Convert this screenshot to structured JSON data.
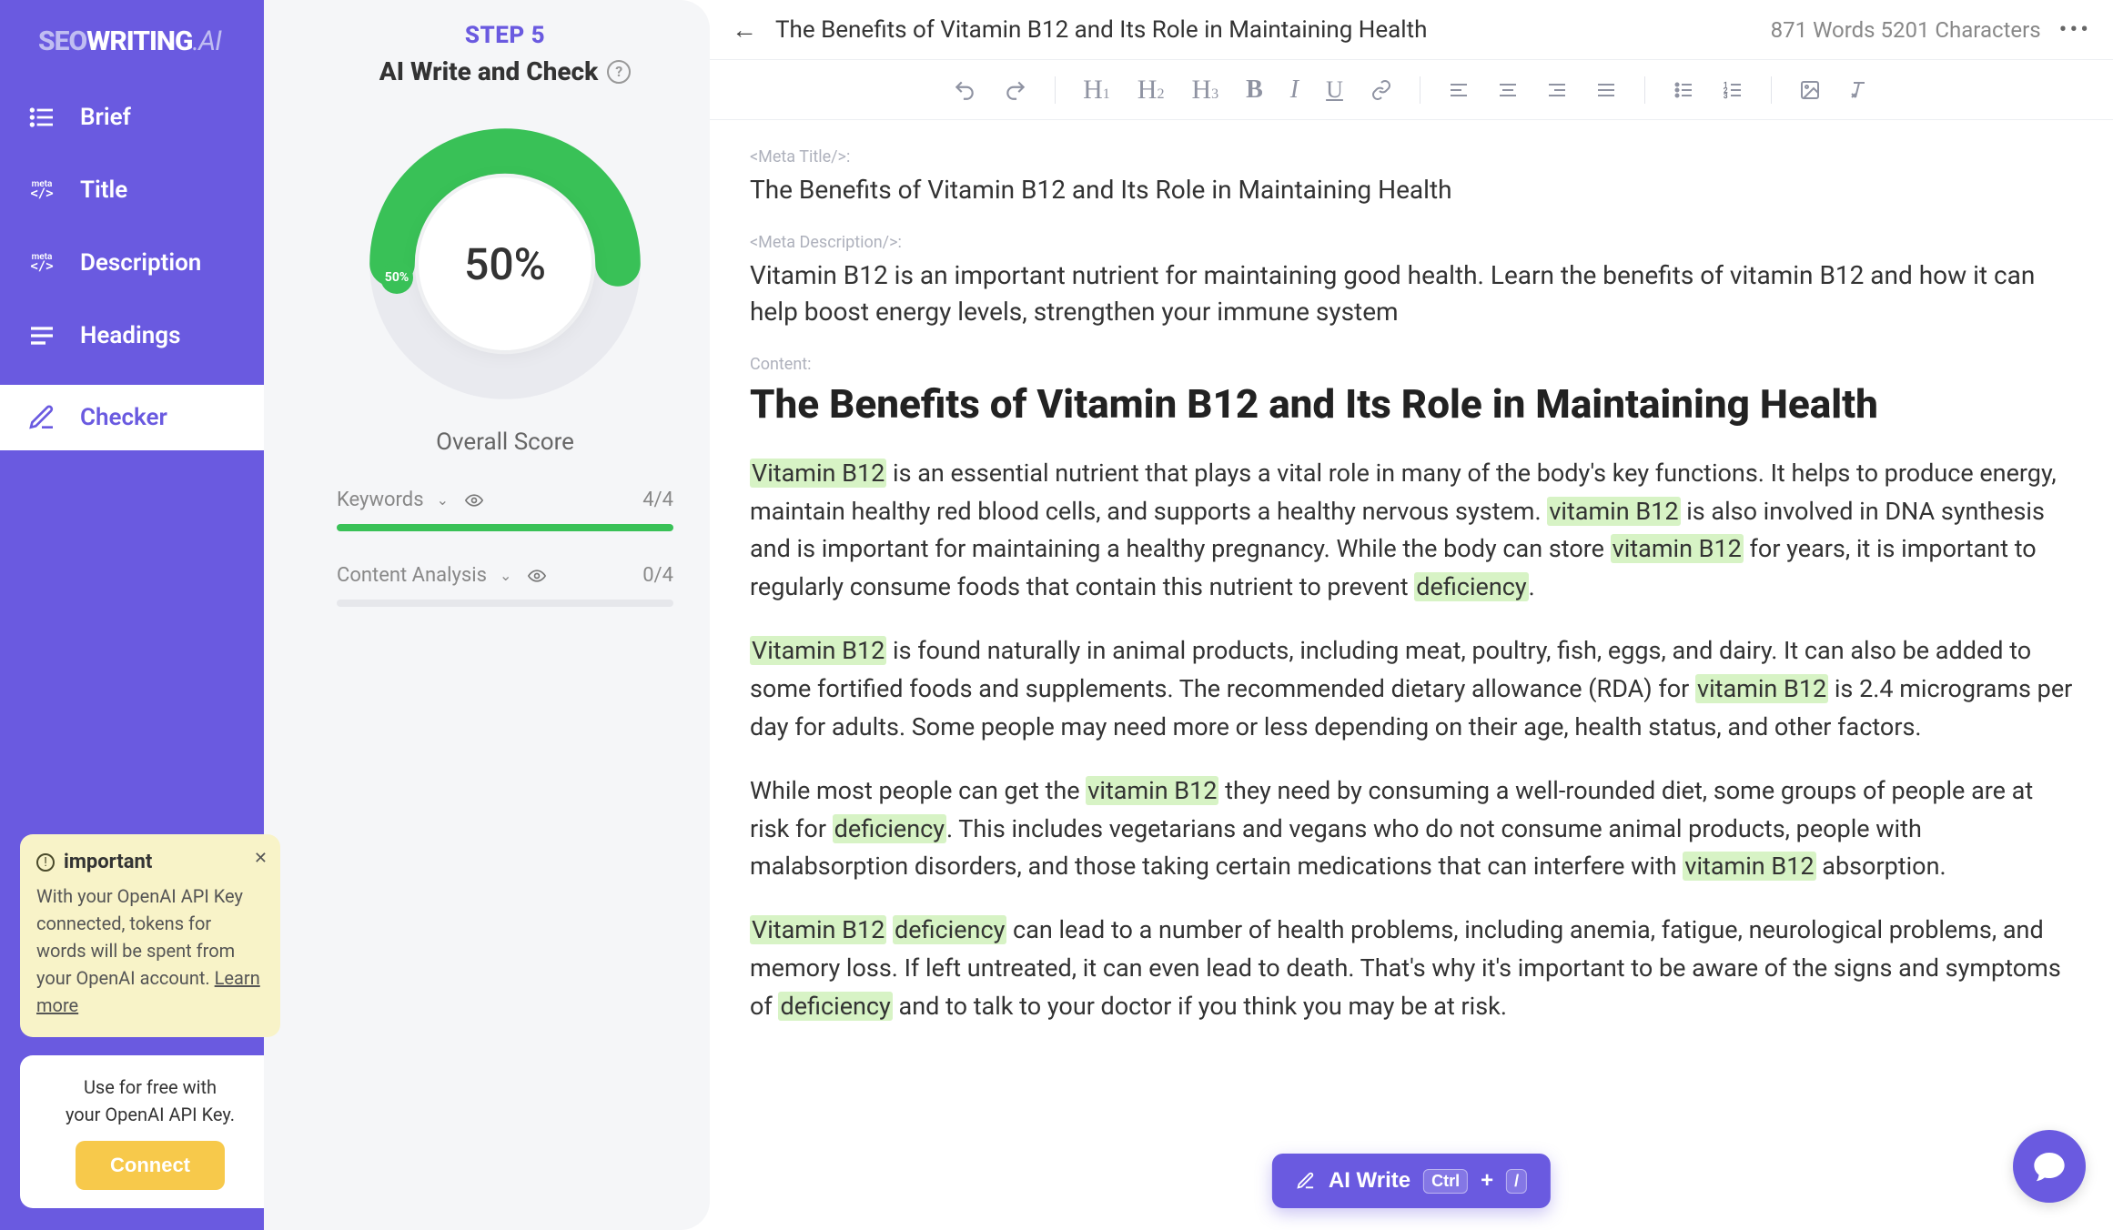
{
  "brand": {
    "part1": "SEO",
    "part2": "WRITING",
    "part3": ".AI"
  },
  "sidebar": {
    "items": [
      {
        "label": "Brief"
      },
      {
        "label": "Title"
      },
      {
        "label": "Description"
      },
      {
        "label": "Headings"
      },
      {
        "label": "Checker"
      }
    ],
    "note": {
      "title": "important",
      "body_prefix": "With your OpenAI API Key connected, tokens for words will be spent from your OpenAI account. ",
      "learn_more": "Learn more"
    },
    "connect": {
      "line1": "Use for free with",
      "line2": "your OpenAI API Key.",
      "button": "Connect"
    }
  },
  "score": {
    "step": "STEP 5",
    "title": "AI Write and Check",
    "percent": "50%",
    "badge": "50%",
    "overall": "Overall Score",
    "metrics": [
      {
        "label": "Keywords",
        "value": "4/4",
        "fill": 100,
        "color": "#39c157"
      },
      {
        "label": "Content Analysis",
        "value": "0/4",
        "fill": 0,
        "color": "#d8dae0"
      }
    ]
  },
  "editor": {
    "title": "The Benefits of Vitamin B12 and Its Role in Maintaining Health",
    "stats": "871 Words 5201 Characters",
    "meta_title_label": "<Meta Title/>:",
    "meta_title": "The Benefits of Vitamin B12 and Its Role in Maintaining Health",
    "meta_desc_label": "<Meta Description/>:",
    "meta_desc": "Vitamin B12 is an important nutrient for maintaining good health. Learn the benefits of vitamin B12 and how it can help boost energy levels, strengthen your immune system",
    "content_label": "Content:",
    "h1": "The Benefits of Vitamin B12 and Its Role in Maintaining Health",
    "p1_a": "Vitamin B12",
    "p1_b": " is an essential nutrient that plays a vital role in many of the body's key functions. It helps to produce energy, maintain healthy red blood cells, and supports a healthy nervous system. ",
    "p1_c": "vitamin B12",
    "p1_d": " is also involved in DNA synthesis and is important for maintaining a healthy pregnancy. While the body can store ",
    "p1_e": "vitamin B12",
    "p1_f": " for years, it is important to regularly consume foods that contain this nutrient to prevent ",
    "p1_g": "deficiency",
    "p1_h": ".",
    "p2_a": "Vitamin B12",
    "p2_b": " is found naturally in animal products, including meat, poultry, fish, eggs, and dairy. It can also be added to some fortified foods and supplements. The recommended dietary allowance (RDA) for ",
    "p2_c": "vitamin B12",
    "p2_d": " is 2.4 micrograms per day for adults. Some people may need more or less depending on their age, health status, and other factors.",
    "p3_a": "While most people can get the ",
    "p3_b": "vitamin B12",
    "p3_c": " they need by consuming a well-rounded diet, some groups of people are at risk for ",
    "p3_d": "deficiency",
    "p3_e": ". This includes vegetarians and vegans who do not consume animal products, people with malabsorption disorders, and those taking certain medications that can interfere with ",
    "p3_f": "vitamin B12",
    "p3_g": " absorption.",
    "p4_a": "Vitamin B12",
    "p4_b": " ",
    "p4_c": "deficiency",
    "p4_d": " can lead to a number of health problems, including anemia, fatigue, neurological problems, and memory loss. If left untreated, it can even lead to death. That's why it's important to be aware of the signs and symptoms of ",
    "p4_e": "deficiency",
    "p4_f": " and to talk to your doctor if you think you may be at risk.",
    "ai_write": {
      "label": "AI Write",
      "kbd1": "Ctrl",
      "plus": "+",
      "kbd2": "/"
    }
  },
  "colors": {
    "accent": "#6a5ae0",
    "green": "#39c157"
  }
}
